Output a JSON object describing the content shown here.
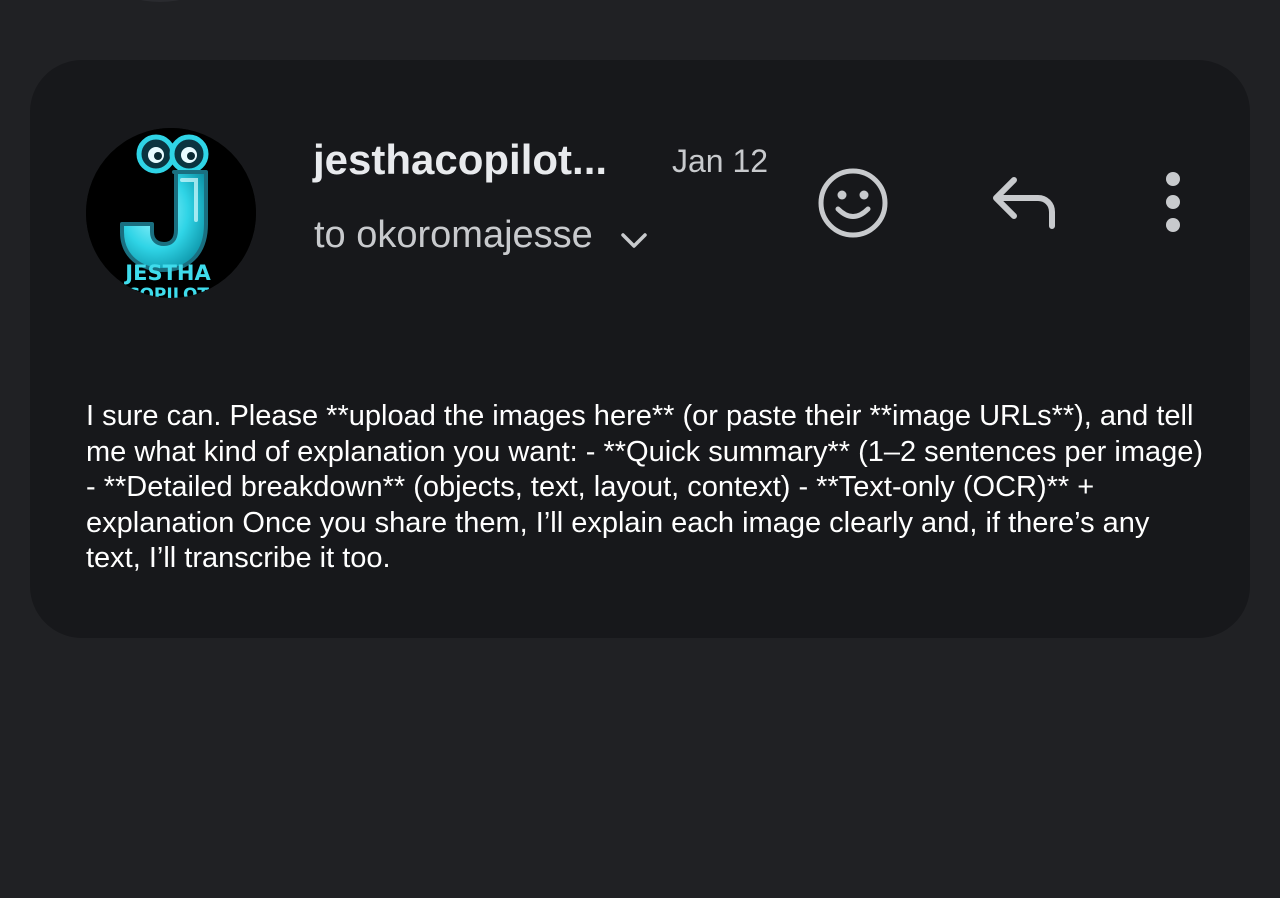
{
  "email": {
    "sender": "jesthacopilot...",
    "date": "Jan 12",
    "recipient": "to okoromajesse",
    "avatar_text_top": "JESTHA",
    "avatar_text_bottom": "COPILOT",
    "avatar_letter": "J",
    "body": "I sure can. Please **upload the images here** (or paste their **image URLs**), and tell me what kind of explanation you want: - **Quick summary** (1–2 sentences per image) - **Detailed breakdown** (objects, text, layout, context) - **Text-only (OCR)** + explanation Once you share them, I’ll explain each image clearly and, if there’s any text, I’ll transcribe it too."
  },
  "actions": {
    "emoji_icon": "smiley-face-icon",
    "reply_icon": "reply-arrow-icon",
    "more_icon": "more-vertical-icon",
    "expand_icon": "chevron-down-icon"
  },
  "colors": {
    "page_bg": "#202124",
    "card_bg": "#17181b",
    "primary_text": "#e8eaed",
    "secondary_text": "#c8cacd",
    "icon": "#c8cacd",
    "avatar_accent": "#2fd4e6"
  }
}
